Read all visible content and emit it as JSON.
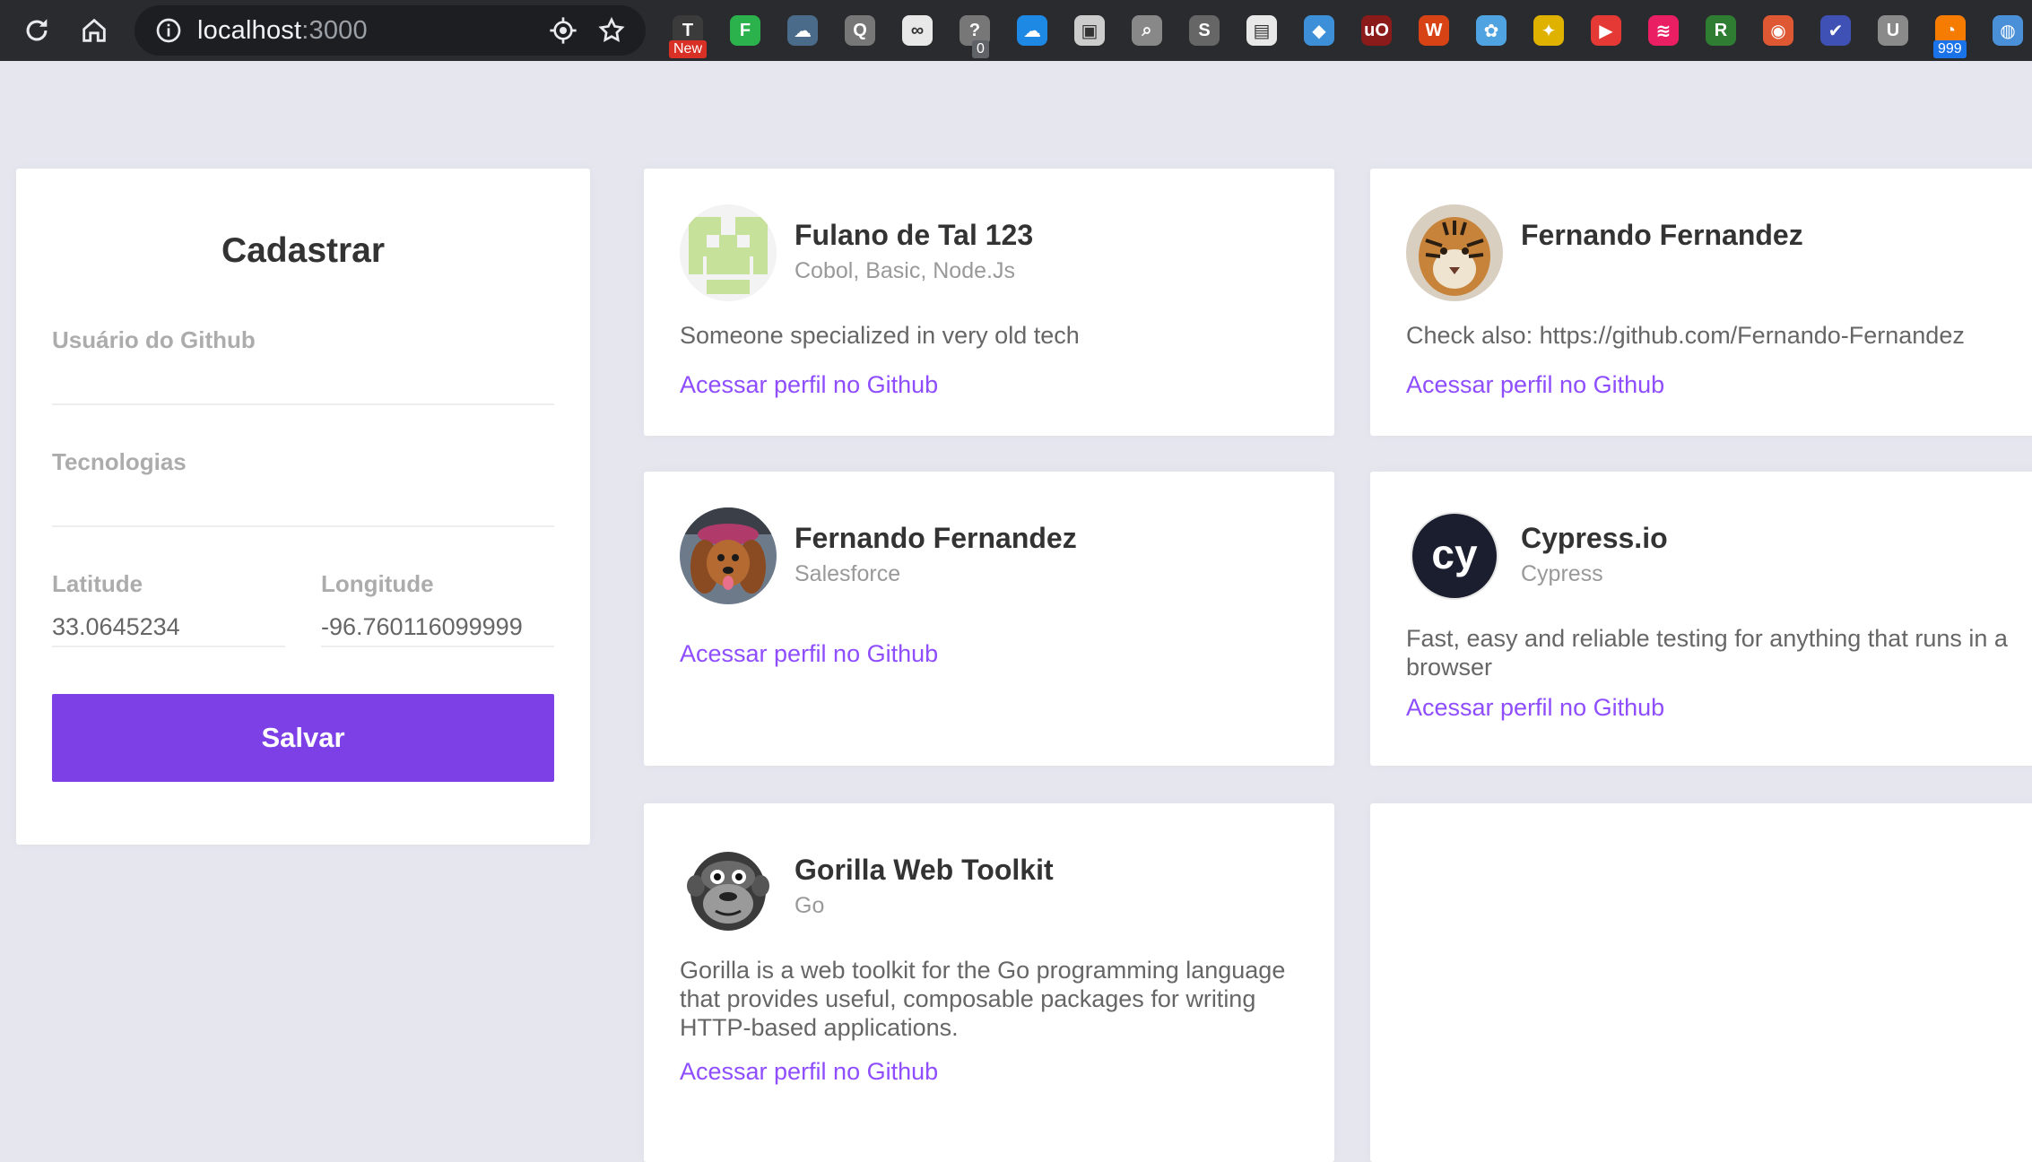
{
  "browser": {
    "url_host": "localhost",
    "url_port": ":3000",
    "extensions": [
      {
        "name": "tampermonkey",
        "glyph": "T",
        "color": "#3b3b3b",
        "badge": "New"
      },
      {
        "name": "feedly",
        "glyph": "F",
        "color": "#2bb24c"
      },
      {
        "name": "cloud-dl",
        "glyph": "☁",
        "color": "#4a6b8a"
      },
      {
        "name": "search-ext",
        "glyph": "Q",
        "color": "#777777"
      },
      {
        "name": "infinity",
        "glyph": "∞",
        "color": "#e8e8e8"
      },
      {
        "name": "help-ext",
        "glyph": "?",
        "color": "#777777",
        "badge": "0"
      },
      {
        "name": "cloud-blue",
        "glyph": "☁",
        "color": "#1e88e5"
      },
      {
        "name": "frame-ext",
        "glyph": "▣",
        "color": "#cccccc"
      },
      {
        "name": "magnifier",
        "glyph": "⌕",
        "color": "#888888"
      },
      {
        "name": "s-ext",
        "glyph": "S",
        "color": "#666666"
      },
      {
        "name": "screenshot-ext",
        "glyph": "▤",
        "color": "#e8e8e8"
      },
      {
        "name": "diamond-ext",
        "glyph": "◆",
        "color": "#3d8fd8"
      },
      {
        "name": "ublock",
        "glyph": "uO",
        "color": "#8b1a1a"
      },
      {
        "name": "wab",
        "glyph": "W",
        "color": "#d84315"
      },
      {
        "name": "brain-ext",
        "glyph": "✿",
        "color": "#4fa3e0"
      },
      {
        "name": "broom-ext",
        "glyph": "✦",
        "color": "#e0b200"
      },
      {
        "name": "youtube-ext",
        "glyph": "▶",
        "color": "#e53935"
      },
      {
        "name": "layers-ext",
        "glyph": "≋",
        "color": "#e91e63"
      },
      {
        "name": "r-ext",
        "glyph": "R",
        "color": "#2e7d32"
      },
      {
        "name": "duckduckgo",
        "glyph": "◉",
        "color": "#de5833"
      },
      {
        "name": "check-ext",
        "glyph": "✔",
        "color": "#3f51b5"
      },
      {
        "name": "u-ext",
        "glyph": "U",
        "color": "#8a8a8a"
      },
      {
        "name": "rss-ext",
        "glyph": "◔",
        "color": "#f57c00",
        "badge": "999"
      },
      {
        "name": "globe-ext",
        "glyph": "◍",
        "color": "#4a90d9"
      }
    ]
  },
  "form": {
    "title": "Cadastrar",
    "github_label": "Usuário do Github",
    "github_value": "",
    "techs_label": "Tecnologias",
    "techs_value": "",
    "latitude_label": "Latitude",
    "latitude_value": "33.0645234",
    "longitude_label": "Longitude",
    "longitude_value": "-96.760116099999",
    "submit_label": "Salvar"
  },
  "devs": [
    {
      "name": "Fulano de Tal 123",
      "techs": "Cobol, Basic, Node.Js",
      "bio": "Someone specialized in very old tech",
      "link": "Acessar perfil no Github",
      "avatar": "identicon-icon"
    },
    {
      "name": "Fernando Fernandez",
      "techs": "",
      "bio": "Check also: https://github.com/Fernando-Fernandez",
      "link": "Acessar perfil no Github",
      "avatar": "tiger-icon"
    },
    {
      "name": "Fernando Fernandez",
      "techs": "Salesforce",
      "bio": "",
      "link": "Acessar perfil no Github",
      "avatar": "dog-icon"
    },
    {
      "name": "Cypress.io",
      "techs": "Cypress",
      "bio": "Fast, easy and reliable testing for anything that runs in a browser",
      "link": "Acessar perfil no Github",
      "avatar": "cypress-logo-icon"
    },
    {
      "name": "Gorilla Web Toolkit",
      "techs": "Go",
      "bio": "Gorilla is a web toolkit for the Go programming language that provides useful, composable packages for writing HTTP-based applications.",
      "link": "Acessar perfil no Github",
      "avatar": "gorilla-icon"
    }
  ],
  "colors": {
    "background": "#e6e6ef",
    "primary": "#7d40e7",
    "link": "#8e4dff"
  }
}
